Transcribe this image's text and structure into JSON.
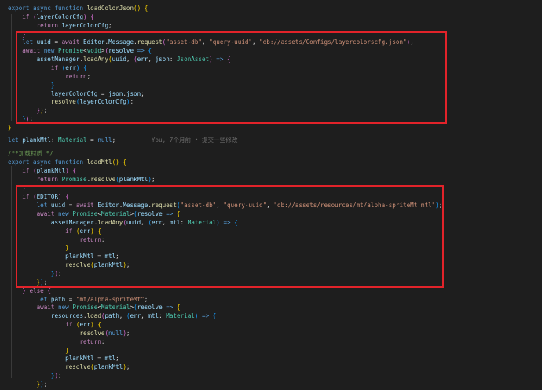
{
  "code_lines": [
    {
      "id": 1,
      "tokens": [
        [
          "kw",
          "export"
        ],
        [
          "",
          "&nbsp;"
        ],
        [
          "kw",
          "async"
        ],
        [
          "",
          "&nbsp;"
        ],
        [
          "kw",
          "function"
        ],
        [
          "",
          "&nbsp;"
        ],
        [
          "fn",
          "loadColorJson"
        ],
        [
          "br1",
          "()"
        ],
        [
          "",
          "&nbsp;"
        ],
        [
          "br1",
          "{"
        ]
      ]
    },
    {
      "id": 2,
      "tokens": [
        [
          "",
          "    "
        ],
        [
          "ctrl",
          "if"
        ],
        [
          "",
          ""
        ],
        [
          "br2",
          "("
        ],
        [
          "var",
          "layerColorCfg"
        ],
        [
          "br2",
          ")"
        ],
        [
          "",
          "&nbsp;"
        ],
        [
          "br2",
          "{"
        ]
      ]
    },
    {
      "id": 3,
      "tokens": [
        [
          "",
          "        "
        ],
        [
          "ctrl",
          "return"
        ],
        [
          "",
          "&nbsp;"
        ],
        [
          "var",
          "layerColorCfg"
        ],
        [
          "",
          ";"
        ]
      ]
    },
    {
      "id": 4,
      "tokens": [
        [
          "",
          "    "
        ],
        [
          "br2",
          "}"
        ]
      ]
    },
    {
      "id": 5,
      "tokens": [
        [
          "",
          "    "
        ],
        [
          "kw",
          "let"
        ],
        [
          "",
          "&nbsp;"
        ],
        [
          "var",
          "uuid"
        ],
        [
          "",
          "&nbsp;=&nbsp;"
        ],
        [
          "ctrl",
          "await"
        ],
        [
          "",
          "&nbsp;"
        ],
        [
          "var",
          "Editor"
        ],
        [
          "",
          "."
        ],
        [
          "var",
          "Message"
        ],
        [
          "",
          "."
        ],
        [
          "fn",
          "request"
        ],
        [
          "br2",
          "("
        ],
        [
          "str",
          "\"asset-db\""
        ],
        [
          ",",
          ", "
        ],
        [
          "str",
          "\"query-uuid\""
        ],
        [
          ",",
          ", "
        ],
        [
          "str",
          "\"db://assets/Configs/layercolorscfg.json\""
        ],
        [
          "br2",
          ")"
        ],
        [
          "",
          ";"
        ]
      ]
    },
    {
      "id": 6,
      "tokens": [
        [
          "",
          "    "
        ],
        [
          "ctrl",
          "await"
        ],
        [
          "",
          "&nbsp;"
        ],
        [
          "kw",
          "new"
        ],
        [
          "",
          "&nbsp;"
        ],
        [
          "ty",
          "Promise"
        ],
        [
          "",
          "<"
        ],
        [
          "ty",
          "void"
        ],
        [
          "",
          ">"
        ],
        [
          "br2",
          "("
        ],
        [
          "var",
          "resolve"
        ],
        [
          "",
          "&nbsp;"
        ],
        [
          "kw",
          "=&gt;"
        ],
        [
          "",
          "&nbsp;"
        ],
        [
          "br3",
          "{"
        ]
      ]
    },
    {
      "id": 7,
      "tokens": [
        [
          "",
          "        "
        ],
        [
          "var",
          "assetManager"
        ],
        [
          "",
          "."
        ],
        [
          "fn",
          "loadAny"
        ],
        [
          "br1",
          "("
        ],
        [
          "var",
          "uuid"
        ],
        [
          "",
          ", "
        ],
        [
          "br2",
          "("
        ],
        [
          "var",
          "err"
        ],
        [
          "",
          ", "
        ],
        [
          "var",
          "json"
        ],
        [
          "",
          ": "
        ],
        [
          "ty",
          "JsonAsset"
        ],
        [
          "br2",
          ")"
        ],
        [
          "",
          "&nbsp;"
        ],
        [
          "kw",
          "=&gt;"
        ],
        [
          "",
          "&nbsp;"
        ],
        [
          "br2",
          "{"
        ]
      ]
    },
    {
      "id": 8,
      "tokens": [
        [
          "",
          "            "
        ],
        [
          "ctrl",
          "if"
        ],
        [
          "",
          "&nbsp;"
        ],
        [
          "br3",
          "("
        ],
        [
          "var",
          "err"
        ],
        [
          "br3",
          ")"
        ],
        [
          "",
          "&nbsp;"
        ],
        [
          "br3",
          "{"
        ]
      ]
    },
    {
      "id": 9,
      "tokens": [
        [
          "",
          "                "
        ],
        [
          "ctrl",
          "return"
        ],
        [
          "",
          ";"
        ]
      ]
    },
    {
      "id": 10,
      "tokens": [
        [
          "",
          "            "
        ],
        [
          "br3",
          "}"
        ]
      ]
    },
    {
      "id": 11,
      "tokens": [
        [
          "",
          "            "
        ],
        [
          "var",
          "layerColorCfg"
        ],
        [
          "",
          "&nbsp;=&nbsp;"
        ],
        [
          "var",
          "json"
        ],
        [
          "",
          "."
        ],
        [
          "var",
          "json"
        ],
        [
          "",
          ";"
        ]
      ]
    },
    {
      "id": 12,
      "tokens": [
        [
          "",
          "            "
        ],
        [
          "fn",
          "resolve"
        ],
        [
          "br3",
          "("
        ],
        [
          "var",
          "layerColorCfg"
        ],
        [
          "br3",
          ")"
        ],
        [
          "",
          ";"
        ]
      ]
    },
    {
      "id": 13,
      "tokens": [
        [
          "",
          "        "
        ],
        [
          "br2",
          "}"
        ],
        [
          "br1",
          ")"
        ],
        [
          "",
          ";"
        ]
      ]
    },
    {
      "id": 14,
      "tokens": [
        [
          "",
          "    "
        ],
        [
          "br3",
          "}"
        ],
        [
          "br2",
          ")"
        ],
        [
          "",
          ";"
        ]
      ]
    },
    {
      "id": 15,
      "tokens": [
        [
          "br1",
          "}"
        ]
      ]
    }
  ],
  "lines": {
    "l1": "export async function loadColorJson() {",
    "l2": "    if (layerColorCfg) {",
    "l3": "        return layerColorCfg;",
    "l4": "    }",
    "l5": "    let uuid = await Editor.Message.request(\"asset-db\", \"query-uuid\", \"db://assets/Configs/layercolorscfg.json\");",
    "l6": "    await new Promise<void>(resolve => {",
    "l7": "        assetManager.loadAny(uuid, (err, json: JsonAsset) => {",
    "l8": "            if (err) {",
    "l9": "                return;",
    "l10": "            }",
    "l11": "            layerColorCfg = json.json;",
    "l12": "            resolve(layerColorCfg);",
    "l13": "        });",
    "l14": "    });",
    "l15": "}",
    "l16": "",
    "l17": "let plankMtl: Material = null;",
    "l17_blame": "You, 7个月前 • 提交一些修改",
    "l18": "",
    "l19": "/**加载材质 */",
    "l20": "export async function loadMtl() {",
    "l21": "    if (plankMtl) {",
    "l22": "        return Promise.resolve(plankMtl);",
    "l23": "    }",
    "l24": "    if (EDITOR) {",
    "l25": "        let uuid = await Editor.Message.request(\"asset-db\", \"query-uuid\", \"db://assets/resources/mt/alpha-spriteMt.mtl\");",
    "l26": "        await new Promise<Material>(resolve => {",
    "l27": "            assetManager.loadAny(uuid, (err, mtl: Material) => {",
    "l28": "                if (err) {",
    "l29": "                    return;",
    "l30": "                }",
    "l31": "                plankMtl = mtl;",
    "l32": "                resolve(plankMtl);",
    "l33": "            });",
    "l34": "        });",
    "l35": "    } else {",
    "l36": "        let path = \"mt/alpha-spriteMt\";",
    "l37": "        await new Promise<Material>(resolve => {",
    "l38": "            resources.load(path, (err, mtl: Material) => {",
    "l39": "                if (err) {",
    "l40": "                    resolve(null);",
    "l41": "                    return;",
    "l42": "                }",
    "l43": "                plankMtl = mtl;",
    "l44": "                resolve(plankMtl);",
    "l45": "            });",
    "l46": "        });",
    "l47": "    }",
    "l48": "}"
  },
  "colors": {
    "background": "#1e1e1e",
    "highlight_box": "#e2232a",
    "keyword": "#569cd6",
    "control": "#c586c0",
    "function": "#dcdcaa",
    "variable": "#9cdcfe",
    "type": "#4ec9b0",
    "string": "#ce9178",
    "comment": "#6a9955"
  }
}
